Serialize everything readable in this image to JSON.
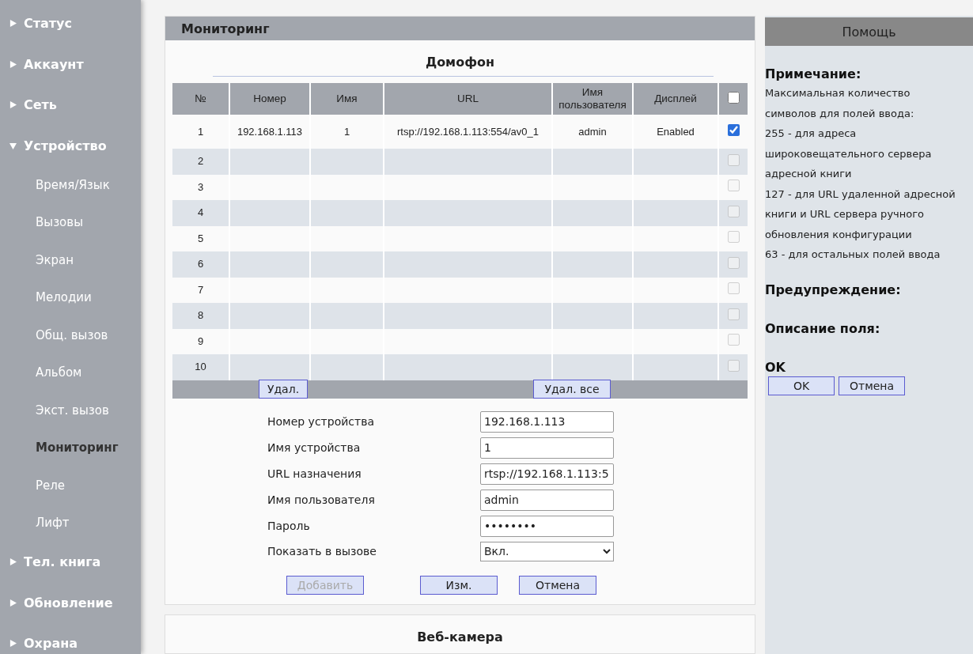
{
  "sidebar": {
    "items": [
      {
        "label": "Статус",
        "expanded": false
      },
      {
        "label": "Аккаунт",
        "expanded": false
      },
      {
        "label": "Сеть",
        "expanded": false
      },
      {
        "label": "Устройство",
        "expanded": true,
        "children": [
          {
            "label": "Время/Язык",
            "selected": false
          },
          {
            "label": "Вызовы",
            "selected": false
          },
          {
            "label": "Экран",
            "selected": false
          },
          {
            "label": "Мелодии",
            "selected": false
          },
          {
            "label": "Общ. вызов",
            "selected": false
          },
          {
            "label": "Альбом",
            "selected": false
          },
          {
            "label": "Экст. вызов",
            "selected": false
          },
          {
            "label": "Мониторинг",
            "selected": true
          },
          {
            "label": "Реле",
            "selected": false
          },
          {
            "label": "Лифт",
            "selected": false
          }
        ]
      },
      {
        "label": "Тел. книга",
        "expanded": false
      },
      {
        "label": "Обновление",
        "expanded": false
      },
      {
        "label": "Охрана",
        "expanded": false
      }
    ]
  },
  "main": {
    "title": "Мониторинг",
    "section_title": "Домофон",
    "table": {
      "columns": [
        "№",
        "Номер",
        "Имя",
        "URL",
        "Имя пользователя",
        "Дисплей"
      ],
      "header_checked": false,
      "rows": [
        {
          "cells": [
            "1",
            "192.168.1.113",
            "1",
            "rtsp://192.168.1.113:554/av0_1",
            "admin",
            "Enabled"
          ],
          "checked": true,
          "disabled": false
        },
        {
          "cells": [
            "2",
            "",
            "",
            "",
            "",
            ""
          ],
          "checked": false,
          "disabled": true
        },
        {
          "cells": [
            "3",
            "",
            "",
            "",
            "",
            ""
          ],
          "checked": false,
          "disabled": true
        },
        {
          "cells": [
            "4",
            "",
            "",
            "",
            "",
            ""
          ],
          "checked": false,
          "disabled": true
        },
        {
          "cells": [
            "5",
            "",
            "",
            "",
            "",
            ""
          ],
          "checked": false,
          "disabled": true
        },
        {
          "cells": [
            "6",
            "",
            "",
            "",
            "",
            ""
          ],
          "checked": false,
          "disabled": true
        },
        {
          "cells": [
            "7",
            "",
            "",
            "",
            "",
            ""
          ],
          "checked": false,
          "disabled": true
        },
        {
          "cells": [
            "8",
            "",
            "",
            "",
            "",
            ""
          ],
          "checked": false,
          "disabled": true
        },
        {
          "cells": [
            "9",
            "",
            "",
            "",
            "",
            ""
          ],
          "checked": false,
          "disabled": true
        },
        {
          "cells": [
            "10",
            "",
            "",
            "",
            "",
            ""
          ],
          "checked": false,
          "disabled": true
        }
      ],
      "delete_button": "Удал.",
      "delete_all_button": "Удал. все"
    },
    "form": [
      {
        "kind": "text",
        "label": "Номер устройства",
        "value": "192.168.1.113"
      },
      {
        "kind": "text",
        "label": "Имя устройства",
        "value": "1"
      },
      {
        "kind": "text",
        "label": "URL назначения",
        "value": "rtsp://192.168.1.113:5"
      },
      {
        "kind": "text",
        "label": "Имя пользователя",
        "value": "admin"
      },
      {
        "kind": "password",
        "label": "Пароль",
        "value": "••••••••"
      },
      {
        "kind": "select",
        "label": "Показать в вызове",
        "value": "Вкл."
      }
    ],
    "buttons": [
      {
        "label": "Добавить",
        "disabled": true
      },
      {
        "label": "Изм.",
        "disabled": false
      },
      {
        "label": "Отмена",
        "disabled": false
      }
    ],
    "next_section_title": "Веб-камера"
  },
  "help": {
    "title": "Помощь",
    "note_heading": "Примечание:",
    "note_lines": [
      "Максимальная количество символов для полей ввода:",
      "255 - для адреса широковещательного сервера адресной книги",
      "127 - для URL удаленной адресной книги и URL сервера ручного обновления конфигурации",
      "63 - для остальных полей ввода"
    ],
    "warning_heading": "Предупреждение:",
    "field_heading": "Описание поля:",
    "ok_heading": "OK",
    "buttons": [
      "OK",
      "Отмена"
    ]
  }
}
